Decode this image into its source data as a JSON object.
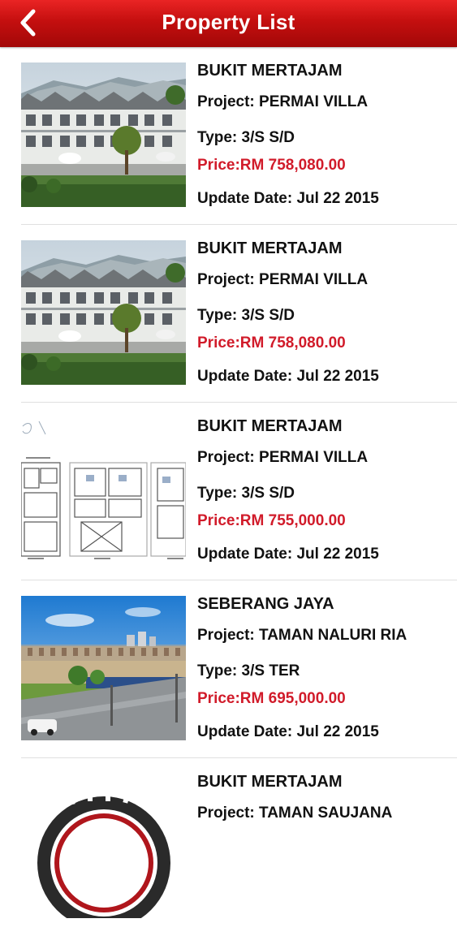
{
  "header": {
    "title": "Property List"
  },
  "colors": {
    "header_red": "#c40f0f",
    "price_red": "#d11b2a"
  },
  "properties": [
    {
      "location": "BUKIT MERTAJAM",
      "project": "Project: PERMAI VILLA",
      "type": "Type: 3/S S/D",
      "price": "Price:RM 758,080.00",
      "update": "Update Date: Jul 22 2015",
      "image": "townhouse-render"
    },
    {
      "location": "BUKIT MERTAJAM",
      "project": "Project: PERMAI VILLA",
      "type": "Type: 3/S S/D",
      "price": "Price:RM 758,080.00",
      "update": "Update Date: Jul 22 2015",
      "image": "townhouse-render"
    },
    {
      "location": "BUKIT MERTAJAM",
      "project": "Project: PERMAI VILLA",
      "type": "Type: 3/S S/D",
      "price": "Price:RM 755,000.00",
      "update": "Update Date: Jul 22 2015",
      "image": "floor-plan"
    },
    {
      "location": "SEBERANG JAYA",
      "project": "Project: TAMAN NALURI RIA",
      "type": "Type: 3/S TER",
      "price": "Price:RM 695,000.00",
      "update": "Update Date: Jul 22 2015",
      "image": "site-photo"
    },
    {
      "location": "BUKIT MERTAJAM",
      "project": "Project: TAMAN SAUJANA",
      "image": "agency-logo"
    }
  ]
}
